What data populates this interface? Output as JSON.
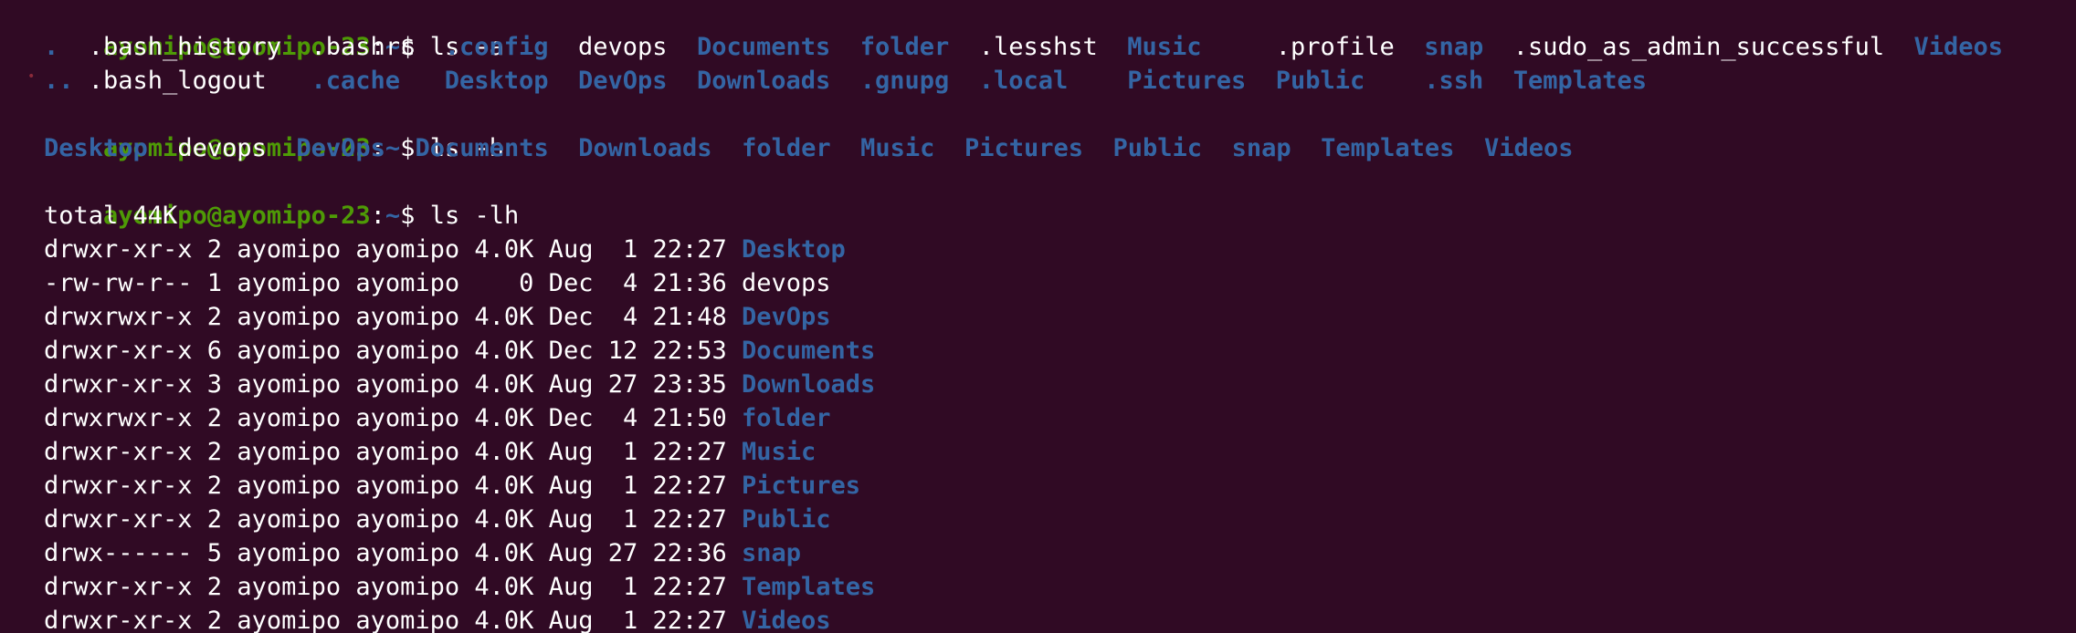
{
  "prompt": {
    "user_host": "ayomipo@ayomipo-23",
    "sep": ":",
    "cwd": "~",
    "symbol": "$ "
  },
  "commands": {
    "c1": "ls -a",
    "c2": "ls -h",
    "c3": "ls -lh"
  },
  "ls_a": {
    "row1": [
      {
        "name": ".",
        "type": "dir"
      },
      {
        "name": ".bash_history",
        "type": "file"
      },
      {
        "name": ".bashrc",
        "type": "file"
      },
      {
        "name": ".config",
        "type": "dir"
      },
      {
        "name": "devops",
        "type": "file"
      },
      {
        "name": "Documents",
        "type": "dir"
      },
      {
        "name": "folder",
        "type": "dir"
      },
      {
        "name": ".lesshst",
        "type": "file"
      },
      {
        "name": "Music",
        "type": "dir"
      },
      {
        "name": ".profile",
        "type": "file"
      },
      {
        "name": "snap",
        "type": "dir"
      },
      {
        "name": ".sudo_as_admin_successful",
        "type": "file"
      },
      {
        "name": "Videos",
        "type": "dir"
      }
    ],
    "row2": [
      {
        "name": "..",
        "type": "dir"
      },
      {
        "name": ".bash_logout",
        "type": "file"
      },
      {
        "name": ".cache",
        "type": "dir"
      },
      {
        "name": "Desktop",
        "type": "dir"
      },
      {
        "name": "DevOps",
        "type": "dir"
      },
      {
        "name": "Downloads",
        "type": "dir"
      },
      {
        "name": ".gnupg",
        "type": "dir"
      },
      {
        "name": ".local",
        "type": "dir"
      },
      {
        "name": "Pictures",
        "type": "dir"
      },
      {
        "name": "Public",
        "type": "dir"
      },
      {
        "name": ".ssh",
        "type": "dir"
      },
      {
        "name": "Templates",
        "type": "dir"
      }
    ]
  },
  "ls_h": [
    {
      "name": "Desktop",
      "type": "dir"
    },
    {
      "name": "devops",
      "type": "file"
    },
    {
      "name": "DevOps",
      "type": "dir"
    },
    {
      "name": "Documents",
      "type": "dir"
    },
    {
      "name": "Downloads",
      "type": "dir"
    },
    {
      "name": "folder",
      "type": "dir"
    },
    {
      "name": "Music",
      "type": "dir"
    },
    {
      "name": "Pictures",
      "type": "dir"
    },
    {
      "name": "Public",
      "type": "dir"
    },
    {
      "name": "snap",
      "type": "dir"
    },
    {
      "name": "Templates",
      "type": "dir"
    },
    {
      "name": "Videos",
      "type": "dir"
    }
  ],
  "ls_lh": {
    "total": "total 44K",
    "entries": [
      {
        "prefix": "drwxr-xr-x 2 ayomipo ayomipo 4.0K Aug  1 22:27 ",
        "name": "Desktop",
        "type": "dir"
      },
      {
        "prefix": "-rw-rw-r-- 1 ayomipo ayomipo    0 Dec  4 21:36 ",
        "name": "devops",
        "type": "file"
      },
      {
        "prefix": "drwxrwxr-x 2 ayomipo ayomipo 4.0K Dec  4 21:48 ",
        "name": "DevOps",
        "type": "dir"
      },
      {
        "prefix": "drwxr-xr-x 6 ayomipo ayomipo 4.0K Dec 12 22:53 ",
        "name": "Documents",
        "type": "dir"
      },
      {
        "prefix": "drwxr-xr-x 3 ayomipo ayomipo 4.0K Aug 27 23:35 ",
        "name": "Downloads",
        "type": "dir"
      },
      {
        "prefix": "drwxrwxr-x 2 ayomipo ayomipo 4.0K Dec  4 21:50 ",
        "name": "folder",
        "type": "dir"
      },
      {
        "prefix": "drwxr-xr-x 2 ayomipo ayomipo 4.0K Aug  1 22:27 ",
        "name": "Music",
        "type": "dir"
      },
      {
        "prefix": "drwxr-xr-x 2 ayomipo ayomipo 4.0K Aug  1 22:27 ",
        "name": "Pictures",
        "type": "dir"
      },
      {
        "prefix": "drwxr-xr-x 2 ayomipo ayomipo 4.0K Aug  1 22:27 ",
        "name": "Public",
        "type": "dir"
      },
      {
        "prefix": "drwx------ 5 ayomipo ayomipo 4.0K Aug 27 22:36 ",
        "name": "snap",
        "type": "dir"
      },
      {
        "prefix": "drwxr-xr-x 2 ayomipo ayomipo 4.0K Aug  1 22:27 ",
        "name": "Templates",
        "type": "dir"
      },
      {
        "prefix": "drwxr-xr-x 2 ayomipo ayomipo 4.0K Aug  1 22:27 ",
        "name": "Videos",
        "type": "dir"
      }
    ]
  },
  "colors": {
    "background": "#300a24",
    "prompt_user": "#4e9a06",
    "directory": "#3465a4",
    "text": "#ffffff"
  }
}
